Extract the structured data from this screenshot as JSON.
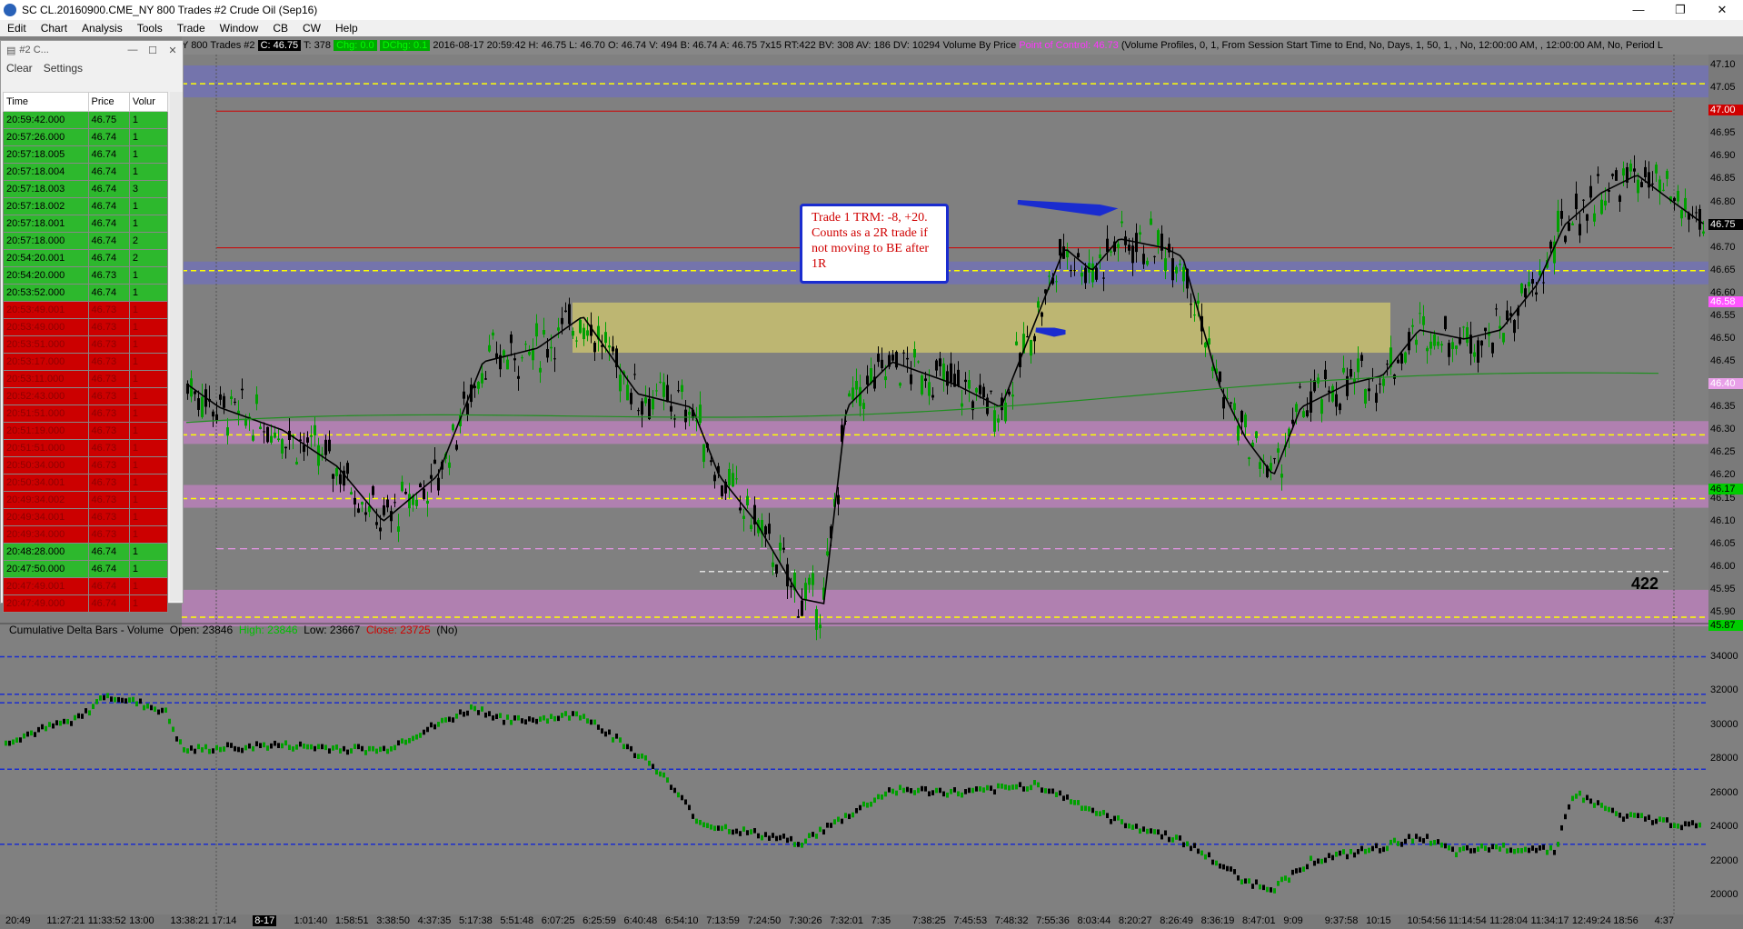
{
  "window": {
    "title": "SC CL.20160900.CME_NY  800 Trades  #2  Crude Oil (Sep16)",
    "controls": [
      "—",
      "❐",
      "✕"
    ]
  },
  "menu": [
    "Edit",
    "Chart",
    "Analysis",
    "Tools",
    "Trade",
    "Window",
    "CB",
    "CW",
    "Help"
  ],
  "infobar": {
    "prefix": "Y  800 Trades  #2",
    "close_box": "C: 46.75",
    "trades": "T: 378",
    "chg_box": "Chg: 0.0",
    "dchg_box": "DChg: 0.1",
    "detail": "2016-08-17 20:59:42  H: 46.75  L: 46.70  O: 46.74  V: 494  B: 46.74  A: 46.75  7x15  RT:422  BV: 308  AV: 186  DV: 10294  Volume By Price",
    "poc": "Point of Control: 46.73",
    "profile": "(Volume Profiles, 0, 1, From Session Start Time to End, No, Days, 1, 50, 1, , No, 12:00:00 AM, , 12:00:00 AM, No, Period L"
  },
  "time_and_sales": {
    "window_title": "#2 C...",
    "buttons": {
      "clear": "Clear",
      "settings": "Settings"
    },
    "columns": [
      "Time",
      "Price",
      "Volur"
    ],
    "rows": [
      {
        "time": "20:59:42.000",
        "price": "46.75",
        "vol": "1",
        "side": "up"
      },
      {
        "time": "20:57:26.000",
        "price": "46.74",
        "vol": "1",
        "side": "up"
      },
      {
        "time": "20:57:18.005",
        "price": "46.74",
        "vol": "1",
        "side": "up"
      },
      {
        "time": "20:57:18.004",
        "price": "46.74",
        "vol": "1",
        "side": "up"
      },
      {
        "time": "20:57:18.003",
        "price": "46.74",
        "vol": "3",
        "side": "up"
      },
      {
        "time": "20:57:18.002",
        "price": "46.74",
        "vol": "1",
        "side": "up"
      },
      {
        "time": "20:57:18.001",
        "price": "46.74",
        "vol": "1",
        "side": "up"
      },
      {
        "time": "20:57:18.000",
        "price": "46.74",
        "vol": "2",
        "side": "up"
      },
      {
        "time": "20:54:20.001",
        "price": "46.74",
        "vol": "2",
        "side": "up"
      },
      {
        "time": "20:54:20.000",
        "price": "46.73",
        "vol": "1",
        "side": "up"
      },
      {
        "time": "20:53:52.000",
        "price": "46.74",
        "vol": "1",
        "side": "up"
      },
      {
        "time": "20:53:49.001",
        "price": "46.73",
        "vol": "1",
        "side": "dn"
      },
      {
        "time": "20:53:49.000",
        "price": "46.73",
        "vol": "1",
        "side": "dn"
      },
      {
        "time": "20:53:51.000",
        "price": "46.73",
        "vol": "1",
        "side": "dn"
      },
      {
        "time": "20:53:17.000",
        "price": "46.73",
        "vol": "1",
        "side": "dn"
      },
      {
        "time": "20:53:11.000",
        "price": "46.73",
        "vol": "1",
        "side": "dn"
      },
      {
        "time": "20:52:43.000",
        "price": "46.73",
        "vol": "1",
        "side": "dn"
      },
      {
        "time": "20:51:51.000",
        "price": "46.73",
        "vol": "1",
        "side": "dn"
      },
      {
        "time": "20:51:19.000",
        "price": "46.73",
        "vol": "1",
        "side": "dn"
      },
      {
        "time": "20:51:51.000",
        "price": "46.73",
        "vol": "1",
        "side": "dn"
      },
      {
        "time": "20:50:34.000",
        "price": "46.73",
        "vol": "1",
        "side": "dn"
      },
      {
        "time": "20:50:34.001",
        "price": "46.73",
        "vol": "1",
        "side": "dn"
      },
      {
        "time": "20:49:34.002",
        "price": "46.73",
        "vol": "1",
        "side": "dn"
      },
      {
        "time": "20:49:34.001",
        "price": "46.73",
        "vol": "1",
        "side": "dn"
      },
      {
        "time": "20:49:34.000",
        "price": "46.73",
        "vol": "1",
        "side": "dn"
      },
      {
        "time": "20:48:28.000",
        "price": "46.74",
        "vol": "1",
        "side": "up"
      },
      {
        "time": "20:47:50.000",
        "price": "46.74",
        "vol": "1",
        "side": "up"
      },
      {
        "time": "20:47:49.001",
        "price": "46.74",
        "vol": "1",
        "side": "dn"
      },
      {
        "time": "20:47:49.000",
        "price": "46.74",
        "vol": "1",
        "side": "dn"
      }
    ]
  },
  "price_axis": [
    "47.10",
    "47.05",
    "47.00",
    "46.95",
    "46.90",
    "46.85",
    "46.80",
    "46.75",
    "46.70",
    "46.65",
    "46.60",
    "46.55",
    "46.50",
    "46.45",
    "46.40",
    "46.35",
    "46.30",
    "46.25",
    "46.20",
    "46.15",
    "46.10",
    "46.05",
    "46.00",
    "45.95",
    "45.90"
  ],
  "price_tags": {
    "red": "47.00",
    "last": "46.75",
    "pink1": "46.58",
    "pink2": "46.40",
    "green1": "46.17",
    "green2": "45.87"
  },
  "annotation": {
    "text": "Trade 1 TRM: -8, +20. Counts as a 2R trade if not moving to BE after 1R"
  },
  "volume_label": "422",
  "cumdelta": {
    "name": "Cumulative Delta Bars - Volume",
    "open_label": "Open: 23846",
    "high_label": "High: 23846",
    "low_label": "Low: 23667",
    "close_label": "Close: 23725",
    "suffix": "(No)",
    "axis": [
      "34000",
      "32000",
      "30000",
      "28000",
      "26000",
      "24000",
      "22000",
      "20000"
    ]
  },
  "time_axis": [
    "20:49",
    "11:27:21",
    "11:33:52",
    "13:00",
    "13:38:21",
    "17:14",
    "8-17",
    "1:01:40",
    "1:58:51",
    "3:38:50",
    "4:37:35",
    "5:17:38",
    "5:51:48",
    "6:07:25",
    "6:25:59",
    "6:40:48",
    "6:54:10",
    "7:13:59",
    "7:24:50",
    "7:30:26",
    "7:32:01",
    "7:35",
    "7:38:25",
    "7:45:53",
    "7:48:32",
    "7:55:36",
    "8:03:44",
    "8:20:27",
    "8:26:49",
    "8:36:19",
    "8:47:01",
    "9:09",
    "9:37:58",
    "10:15",
    "10:54:56",
    "11:14:54",
    "11:28:04",
    "11:34:17",
    "12:49:24",
    "18:56",
    "4:37"
  ],
  "colors": {
    "background": "#808080",
    "value_area_band": "#6f6fbf",
    "volume_node_band": "#c080c0",
    "pivot_zone": "#c8c070",
    "up_bar": "#00a000",
    "down_bar": "#000000",
    "annotation_border": "#1a2ccf",
    "annotation_text": "#d00000"
  }
}
